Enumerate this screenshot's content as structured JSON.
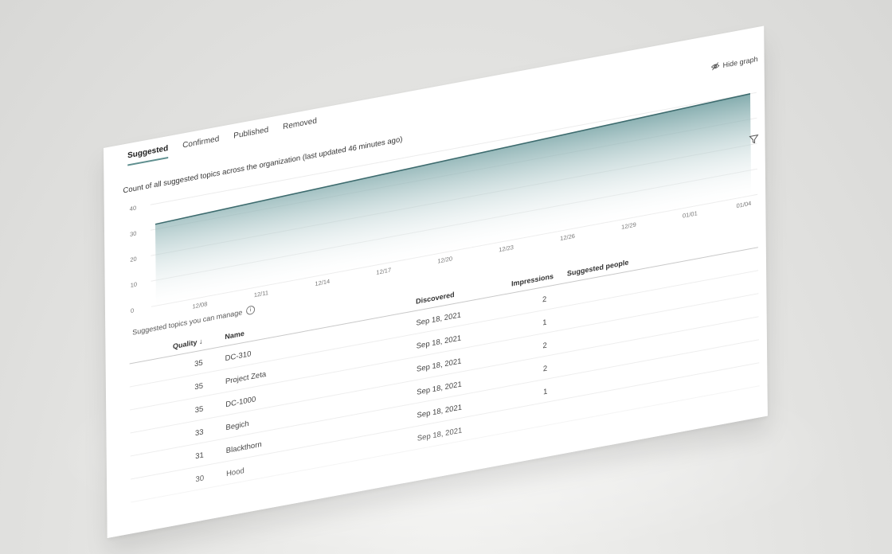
{
  "tabs": [
    "Suggested",
    "Confirmed",
    "Published",
    "Removed"
  ],
  "hide_graph_label": "Hide graph",
  "chart_caption": "Count of all suggested topics across the organization (last updated 46 minutes ago)",
  "chart_data": {
    "type": "area",
    "title": "",
    "x": [
      "12/05",
      "01/04"
    ],
    "x_tick_labels": [
      "12/08",
      "12/11",
      "12/14",
      "12/17",
      "12/20",
      "12/23",
      "12/26",
      "12/29",
      "01/01",
      "01/04"
    ],
    "y_tick_labels": [
      "0",
      "10",
      "20",
      "30",
      "40"
    ],
    "ylim": [
      0,
      40
    ],
    "series": [
      {
        "values": [
          32,
          40
        ]
      }
    ],
    "grid": true,
    "accent": "#3d6b6e"
  },
  "table": {
    "caption": "Suggested topics you can manage",
    "columns": {
      "quality": "Quality ↓",
      "name": "Name",
      "discovered": "Discovered",
      "impressions": "Impressions",
      "people": "Suggested people"
    },
    "rows": [
      {
        "quality": "35",
        "name": "DC-310",
        "discovered": "Sep 18, 2021",
        "impressions": "2"
      },
      {
        "quality": "35",
        "name": "Project Zeta",
        "discovered": "Sep 18, 2021",
        "impressions": "1"
      },
      {
        "quality": "35",
        "name": "DC-1000",
        "discovered": "Sep 18, 2021",
        "impressions": "2"
      },
      {
        "quality": "33",
        "name": "Begich",
        "discovered": "Sep 18, 2021",
        "impressions": "2"
      },
      {
        "quality": "31",
        "name": "Blackthorn",
        "discovered": "Sep 18, 2021",
        "impressions": "1"
      },
      {
        "quality": "30",
        "name": "Hood",
        "discovered": "Sep 18, 2021",
        "impressions": ""
      }
    ]
  }
}
